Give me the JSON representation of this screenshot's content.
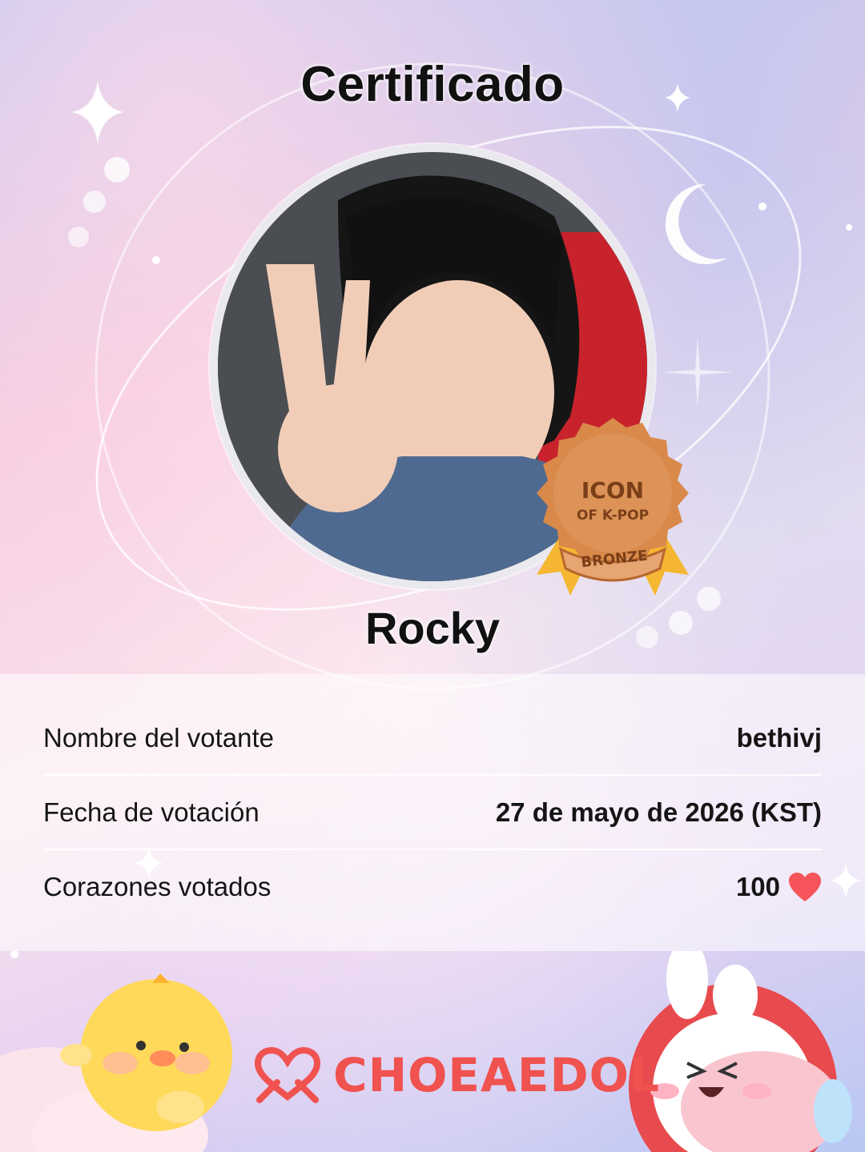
{
  "title": "Certificado",
  "idol_name": "Rocky",
  "badge": {
    "line1": "ICON",
    "line2": "OF K-POP",
    "tier": "BRONZE"
  },
  "details": [
    {
      "label": "Nombre del votante",
      "value": "bethivj"
    },
    {
      "label": "Fecha de votación",
      "value": "27 de mayo de 2026 (KST)"
    },
    {
      "label": "Corazones votados",
      "value": "100"
    }
  ],
  "brand": "CHOEAEDOL",
  "colors": {
    "accent": "#f0524f",
    "badge_bronze": "#d9894a",
    "ribbon": "#f5b731"
  },
  "icons": [
    "heart-icon",
    "choeaedol-logo-icon",
    "sparkle-icon",
    "moon-icon"
  ]
}
